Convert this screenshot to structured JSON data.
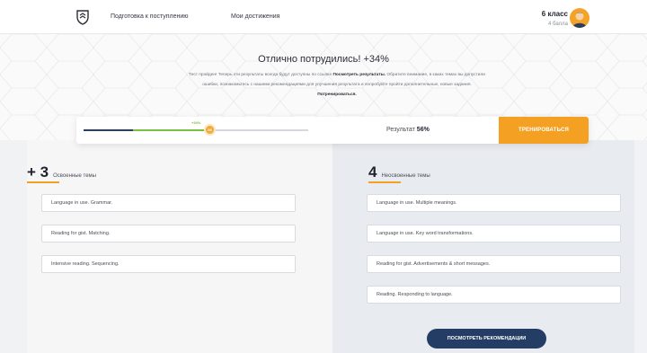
{
  "header": {
    "nav": [
      "Подготовка к поступлению",
      "Мои достижения"
    ],
    "user": {
      "grade": "6 класс",
      "points": "4 балла"
    }
  },
  "hero": {
    "title": "Отлично потрудились! +34%",
    "text_1": "Тест пройден! Теперь эти результаты всегда будут доступны по ссылке ",
    "link_results": "Посмотреть результаты.",
    "text_2": " Обратите внимание, в каких темах вы допустили ошибки, познакомьтесь с нашими рекомендациями для улучшения результата и попробуйте пройти дополнительные, новые задания. ",
    "link_train": "Потренироваться."
  },
  "result": {
    "delta": "+34%",
    "label": "Результат",
    "value": "56%",
    "progress": {
      "previous": 0.22,
      "current": 0.56
    },
    "knob_text": "56",
    "train_button": "ТРЕНИРОВАТЬСЯ"
  },
  "mastered": {
    "count": "+ 3",
    "label": "Освоенные темы",
    "topics": [
      "Language in use. Grammar.",
      "Reading for gist. Matching.",
      "Intensive reading. Sequencing."
    ]
  },
  "unmastered": {
    "count": "4",
    "label": "Неосвоенные темы",
    "topics": [
      "Language in use. Multiple meanings.",
      "Language in use. Key word transformations.",
      "Reading for gist. Advertisements & short messages.",
      "Reading. Responding to language."
    ]
  },
  "recommendations_button": "ПОСМОТРЕТЬ РЕКОМЕНДАЦИИ",
  "colors": {
    "accent": "#f3a023",
    "navy": "#243d64",
    "green": "#7bc043"
  }
}
